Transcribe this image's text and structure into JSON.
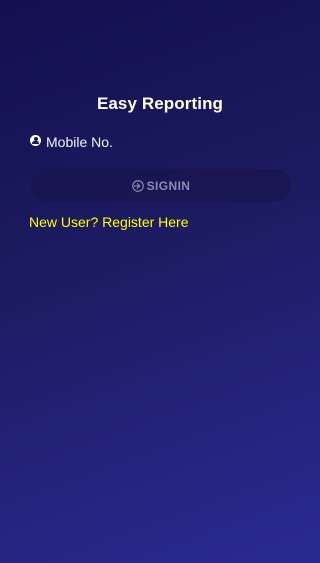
{
  "app": {
    "title": "Easy Reporting"
  },
  "login": {
    "mobile_placeholder": "Mobile No.",
    "signin_label": "SIGNIN",
    "register_text": "New User? Register Here"
  },
  "icons": {
    "mobile": "user-circle-icon",
    "signin": "sign-in-icon"
  },
  "colors": {
    "background_top": "#121050",
    "background_bottom": "#2b2a93",
    "title": "#ffffff",
    "link": "#ffff00",
    "button_bg": "#18164f",
    "button_text": "#8c8ab3"
  }
}
